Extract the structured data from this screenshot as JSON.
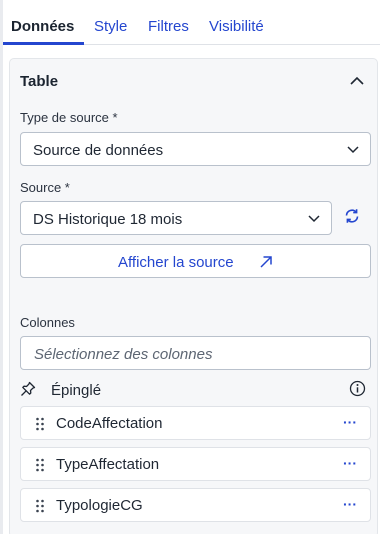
{
  "tabs": [
    {
      "label": "Données",
      "active": true
    },
    {
      "label": "Style",
      "active": false
    },
    {
      "label": "Filtres",
      "active": false
    },
    {
      "label": "Visibilité",
      "active": false
    }
  ],
  "panel": {
    "title": "Table",
    "source_type": {
      "label": "Type de source *",
      "value": "Source de données"
    },
    "source": {
      "label": "Source *",
      "value": "DS Historique 18 mois"
    },
    "view_source_label": "Afficher la source",
    "columns": {
      "label": "Colonnes",
      "placeholder": "Sélectionnez des colonnes",
      "pinned_label": "Épinglé",
      "items": [
        {
          "name": "CodeAffectation"
        },
        {
          "name": "TypeAffectation"
        },
        {
          "name": "TypologieCG"
        }
      ],
      "more_glyph": "···"
    }
  },
  "colors": {
    "accent": "#2446cf",
    "panel_bg": "#f6f7f9",
    "border": "#b9c1cc"
  },
  "icons": [
    "chevron-up-icon",
    "chevron-down-icon",
    "refresh-icon",
    "external-link-icon",
    "pin-icon",
    "info-icon",
    "drag-handle-icon",
    "more-icon"
  ]
}
